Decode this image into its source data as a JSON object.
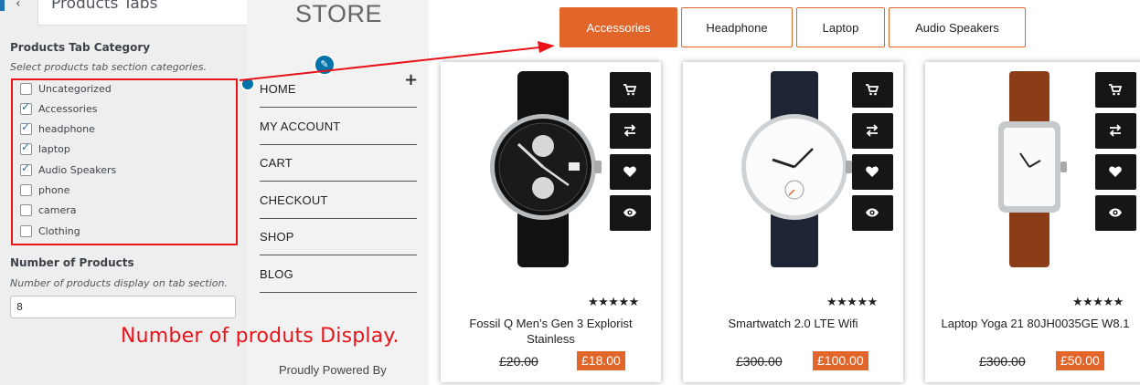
{
  "panel": {
    "section_title": "Products Tabs",
    "back_icon": "chevron-left-icon",
    "tab_category": {
      "label": "Products Tab Category",
      "description": "Select products tab section categories.",
      "items": [
        {
          "label": "Uncategorized",
          "checked": false
        },
        {
          "label": "Accessories",
          "checked": true
        },
        {
          "label": "headphone",
          "checked": true
        },
        {
          "label": "laptop",
          "checked": true
        },
        {
          "label": "Audio Speakers",
          "checked": true
        },
        {
          "label": "phone",
          "checked": false
        },
        {
          "label": "camera",
          "checked": false
        },
        {
          "label": "Clothing",
          "checked": false
        }
      ]
    },
    "number_of_products": {
      "label": "Number of Products",
      "description": "Number of products display on tab section.",
      "value": "8"
    },
    "annotation": "Number of produts Display."
  },
  "site": {
    "store_title": "STORE",
    "menu": [
      "HOME",
      "MY ACCOUNT",
      "CART",
      "CHECKOUT",
      "SHOP",
      "BLOG"
    ],
    "menu_toggle": "+",
    "footer": "Proudly Powered By"
  },
  "tabs": [
    {
      "label": "Accessories",
      "active": true
    },
    {
      "label": "Headphone",
      "active": false
    },
    {
      "label": "Laptop",
      "active": false
    },
    {
      "label": "Audio Speakers",
      "active": false
    }
  ],
  "products": [
    {
      "name": "Fossil Q Men’s Gen 3 Explorist Stainless",
      "old_price": "£20.00",
      "price": "£18.00",
      "stars": "★★★★★",
      "image": "black-chronograph-watch"
    },
    {
      "name": "Smartwatch 2.0 LTE Wifi",
      "old_price": "£300.00",
      "price": "£100.00",
      "stars": "★★★★★",
      "image": "white-dial-watch"
    },
    {
      "name": "Laptop Yoga 21 80JH0035GE W8.1",
      "old_price": "£300.00",
      "price": "£50.00",
      "stars": "★★★★★",
      "image": "brown-leather-watch"
    }
  ],
  "product_actions": [
    "cart-icon",
    "compare-icon",
    "heart-icon",
    "eye-icon"
  ],
  "colors": {
    "accent": "#e2652a",
    "annotation_red": "#e8141a",
    "wp_blue": "#2271b1"
  }
}
